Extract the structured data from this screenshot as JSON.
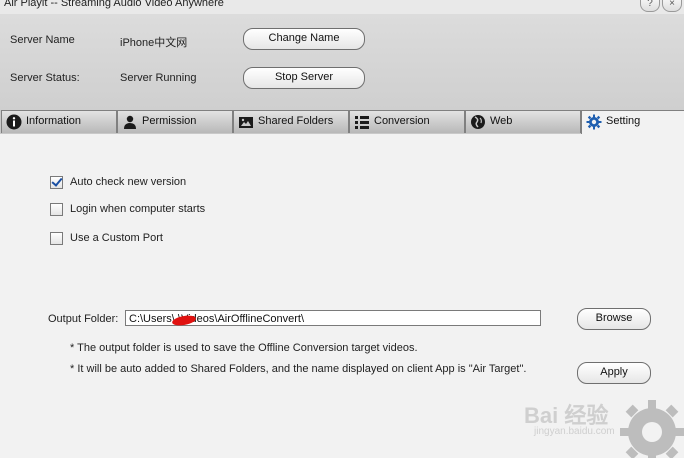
{
  "window": {
    "title": "Air Playit -- Streaming Audio Video Anywhere",
    "help_glyph": "?",
    "close_glyph": "×"
  },
  "server": {
    "name_label": "Server Name",
    "name_value": "iPhone中文网",
    "change_name_button": "Change Name",
    "status_label": "Server Status:",
    "status_value": "Server Running",
    "stop_server_button": "Stop Server"
  },
  "tabs": [
    {
      "label": "Information",
      "icon": "info-icon"
    },
    {
      "label": "Permission",
      "icon": "user-icon"
    },
    {
      "label": "Shared Folders",
      "icon": "shared-folders-icon"
    },
    {
      "label": "Conversion",
      "icon": "list-icon"
    },
    {
      "label": "Web",
      "icon": "web-icon"
    },
    {
      "label": "Setting",
      "icon": "gear-icon",
      "active": true
    }
  ],
  "settings": {
    "auto_check": {
      "label": "Auto check new version",
      "checked": true
    },
    "login_start": {
      "label": "Login when computer starts",
      "checked": false
    },
    "custom_port": {
      "label": "Use a Custom Port",
      "checked": false
    },
    "output_folder_label": "Output Folder:",
    "output_folder_value": "C:\\Users\\     \\Videos\\AirOfflineConvert\\",
    "browse_button": "Browse",
    "note1": "* The output folder is used to save the Offline Conversion target videos.",
    "note2": "* It will be auto added to Shared Folders, and the name displayed on client App is \"Air Target\".",
    "apply_button": "Apply"
  },
  "watermark": {
    "text": "Bai 经验",
    "url": "jingyan.baidu.com"
  },
  "colors": {
    "server_bg": "#d6d6d6",
    "content_bg": "#f2f2f2",
    "redaction": "#e0110f",
    "check": "#1a4fa3"
  }
}
